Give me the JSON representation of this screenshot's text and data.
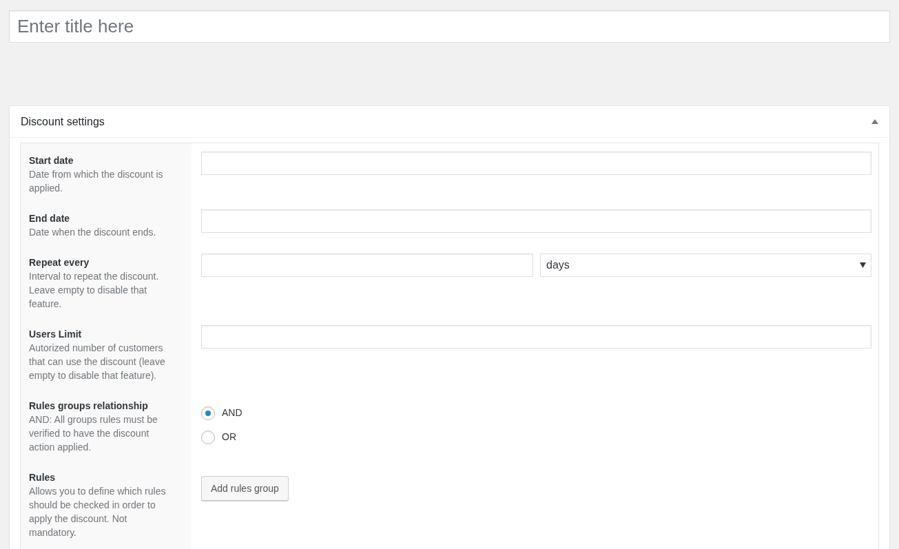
{
  "title_field": {
    "placeholder": "Enter title here"
  },
  "panel": {
    "title": "Discount settings",
    "expanded": true,
    "rows": [
      {
        "kind": "text",
        "label": "Start date",
        "description": "Date from which the discount is applied."
      },
      {
        "kind": "text",
        "label": "End date",
        "description": "Date when the discount ends."
      },
      {
        "kind": "text_select",
        "label": "Repeat every",
        "description": "Interval to repeat the discount. Leave empty to disable that feature.",
        "select_value": "days"
      },
      {
        "kind": "text",
        "label": "Users Limit",
        "description": "Autorized number of customers that can use the discount (leave empty to disable that feature)."
      },
      {
        "kind": "radio",
        "label": "Rules groups relationship",
        "description": "AND: All groups rules must be verified to have the discount action applied.",
        "options": [
          {
            "label": "AND",
            "selected": true
          },
          {
            "label": "OR",
            "selected": false
          }
        ]
      },
      {
        "kind": "button",
        "label": "Rules",
        "description": "Allows you to define which rules should be checked in order to apply the discount. Not mandatory.",
        "button": "Add rules group"
      }
    ]
  }
}
